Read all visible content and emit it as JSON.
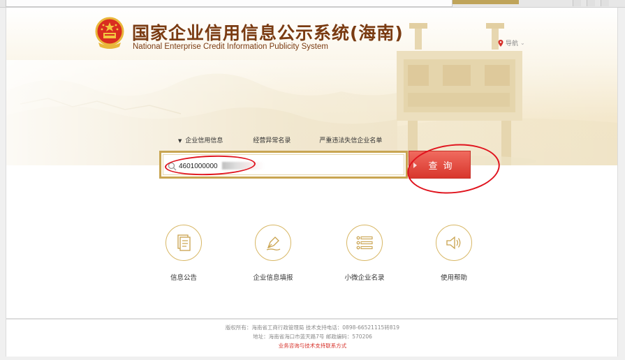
{
  "site": {
    "title_cn": "国家企业信用信息公示系统(海南)",
    "title_en": "National Enterprise Credit Information Publicity System",
    "nav_label": "导航"
  },
  "search": {
    "tabs": [
      "企业信用信息",
      "经营异常名录",
      "严重违法失信企业名单"
    ],
    "query_value": "4601000000",
    "button_label": "查询"
  },
  "quick_links": [
    {
      "label": "信息公告",
      "icon": "document-icon"
    },
    {
      "label": "企业信息填报",
      "icon": "pen-icon"
    },
    {
      "label": "小微企业名录",
      "icon": "list-icon"
    },
    {
      "label": "使用帮助",
      "icon": "speaker-icon"
    }
  ],
  "footer": {
    "line1": "版权所有：海南省工商行政管理局 技术支持电话：0898-66521115转819",
    "line2": "地址：海南省海口市蓝天路7号 邮政编码：570206",
    "contact_link": "业务咨询与技术支持联系方式"
  },
  "colors": {
    "brand_brown": "#7a3b12",
    "gold": "#c8a552",
    "button_red": "#d8362c",
    "annotation_red": "#e0141e"
  }
}
